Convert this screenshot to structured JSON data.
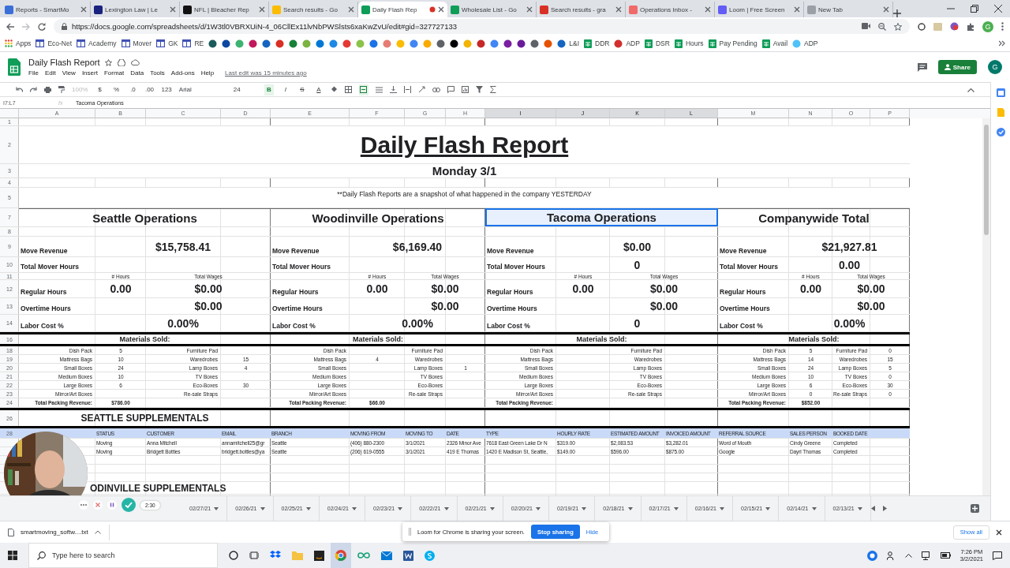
{
  "browser": {
    "tabs": [
      {
        "title": "Reports - SmartMo",
        "selected": false,
        "color": "#3b6fd8"
      },
      {
        "title": "Lexington Law | Le",
        "selected": false,
        "color": "#1a237e"
      },
      {
        "title": "NFL | Bleacher Rep",
        "selected": false,
        "color": "#111111"
      },
      {
        "title": "Search results - Go",
        "selected": false,
        "color": "#fbbc04"
      },
      {
        "title": "Daily Flash Rep",
        "selected": true,
        "color": "#0f9d58"
      },
      {
        "title": "Wholesale List - Go",
        "selected": false,
        "color": "#0f9d58"
      },
      {
        "title": "Search results - gra",
        "selected": false,
        "color": "#d93025"
      },
      {
        "title": "Operations Inbox -",
        "selected": false,
        "color": "#f06a6a"
      },
      {
        "title": "Loom | Free Screen",
        "selected": false,
        "color": "#625df5"
      },
      {
        "title": "New Tab",
        "selected": false,
        "color": "#9aa0a6"
      }
    ],
    "url": "https://docs.google.com/spreadsheets/d/1W3tl0VBRXUiN-4_06CllEx11lvNbPWSlsts6xaKwZvU/edit#gid=327727133",
    "profile": "G",
    "bookmarks": [
      {
        "kind": "apps",
        "label": "Apps"
      },
      {
        "kind": "page",
        "label": "Eco-Net"
      },
      {
        "kind": "page",
        "label": "Academy"
      },
      {
        "kind": "page",
        "label": "Mover"
      },
      {
        "kind": "page",
        "label": "GK"
      },
      {
        "kind": "page",
        "label": "RE"
      },
      {
        "kind": "site",
        "color": "#1a5a5a"
      },
      {
        "kind": "site",
        "color": "#0d47a1"
      },
      {
        "kind": "site",
        "color": "#3cb371"
      },
      {
        "kind": "site",
        "color": "#c2185b"
      },
      {
        "kind": "site",
        "color": "#1565c0"
      },
      {
        "kind": "site",
        "color": "#d93025"
      },
      {
        "kind": "site",
        "color": "#188038"
      },
      {
        "kind": "site",
        "color": "#7cb342"
      },
      {
        "kind": "site",
        "color": "#0078d4"
      },
      {
        "kind": "site",
        "color": "#1e88e5"
      },
      {
        "kind": "site",
        "color": "#e53935"
      },
      {
        "kind": "site",
        "color": "#8bc34a"
      },
      {
        "kind": "site",
        "color": "#1a73e8"
      },
      {
        "kind": "site",
        "color": "#e67c73"
      },
      {
        "kind": "site",
        "color": "#fbbc04"
      },
      {
        "kind": "site",
        "color": "#4285f4"
      },
      {
        "kind": "site",
        "color": "#f9ab00"
      },
      {
        "kind": "site",
        "color": "#5f6368"
      },
      {
        "kind": "site",
        "color": "#000000"
      },
      {
        "kind": "site",
        "color": "#f4b400"
      },
      {
        "kind": "site",
        "color": "#c62828"
      },
      {
        "kind": "site",
        "color": "#4285f5"
      },
      {
        "kind": "site",
        "color": "#7b1fa2"
      },
      {
        "kind": "site",
        "color": "#6a1b9a"
      },
      {
        "kind": "site",
        "color": "#5f6369"
      },
      {
        "kind": "site",
        "color": "#e65100"
      },
      {
        "kind": "site",
        "color": "#1565c1",
        "label": "L&I"
      },
      {
        "kind": "sheet",
        "label": "DDR"
      },
      {
        "kind": "site",
        "color": "#d32f2f",
        "label": "ADP"
      },
      {
        "kind": "sheet",
        "label": "DSR"
      },
      {
        "kind": "sheet",
        "label": "Hours"
      },
      {
        "kind": "sheet",
        "label": "Pay Pending"
      },
      {
        "kind": "sheet",
        "label": "Avail"
      },
      {
        "kind": "site",
        "color": "#4fc3f7",
        "label": "ADP"
      }
    ]
  },
  "doc": {
    "title": "Daily Flash Report",
    "menu": [
      "File",
      "Edit",
      "View",
      "Insert",
      "Format",
      "Data",
      "Tools",
      "Add-ons",
      "Help"
    ],
    "last_edit": "Last edit was 15 minutes ago",
    "share": "Share",
    "avatar": "G"
  },
  "toolbar": {
    "zoom": "100%",
    "currency": "$",
    "percent": "%",
    "decrease": ".0",
    "increase": ".00",
    "format": "123",
    "font": "Arial",
    "size": "24",
    "bold": "B",
    "italic": "I",
    "strike": "S",
    "text_color": "A",
    "bold_active": true,
    "merge_active": true
  },
  "formula": {
    "cell": "I7:L7",
    "fx": "fx",
    "value": "Tacoma Operations"
  },
  "sheet": {
    "columns": [
      {
        "letter": "A",
        "selected": false
      },
      {
        "letter": "B",
        "selected": false
      },
      {
        "letter": "C",
        "selected": false
      },
      {
        "letter": "D",
        "selected": false
      },
      {
        "letter": "E",
        "selected": false
      },
      {
        "letter": "F",
        "selected": false
      },
      {
        "letter": "G",
        "selected": false
      },
      {
        "letter": "H",
        "selected": false
      },
      {
        "letter": "I",
        "selected": true
      },
      {
        "letter": "J",
        "selected": true
      },
      {
        "letter": "K",
        "selected": true
      },
      {
        "letter": "L",
        "selected": true
      },
      {
        "letter": "M",
        "selected": false
      },
      {
        "letter": "N",
        "selected": false
      },
      {
        "letter": "O",
        "selected": false
      },
      {
        "letter": "P",
        "selected": false
      }
    ],
    "row_numbers": [
      "1",
      "2",
      "3",
      "4",
      "5",
      "7",
      "8",
      "9",
      "10",
      "11",
      "12",
      "13",
      "14",
      "16",
      "18",
      "19",
      "20",
      "21",
      "22",
      "23",
      "24",
      "26",
      "28"
    ],
    "title": "Daily Flash Report",
    "date": "Monday 3/1",
    "note": "**Daily Flash Reports are a snapshot of what happened in the company YESTERDAY",
    "sections": [
      {
        "header": "Seattle Operations",
        "selected": false,
        "move_revenue": {
          "label": "Move Revenue",
          "value": "$15,758.41"
        },
        "mover_hours": {
          "label": "Total Mover Hours"
        },
        "hours_head": "# Hours",
        "wages_head": "Total Wages",
        "regular": {
          "label": "Regular Hours",
          "hours": "0.00",
          "wages": "$0.00"
        },
        "overtime": {
          "label": "Overtime Hours",
          "wages": "$0.00"
        },
        "labor": {
          "label": "Labor Cost %",
          "value": "0.00%"
        },
        "materials_title": "Materials Sold:",
        "materials": [
          {
            "left": "Dish Pack",
            "left_qty": "5",
            "right": "Furniture Pad"
          },
          {
            "left": "Mattress Bags",
            "left_qty": "10",
            "right": "Waredrobes",
            "right_qty": "15"
          },
          {
            "left": "Small Boxes",
            "left_qty": "24",
            "right": "Lamp Boxes",
            "right_qty": "4"
          },
          {
            "left": "Medium Boxes",
            "left_qty": "10",
            "right": "TV Boxes"
          },
          {
            "left": "Large Boxes",
            "left_qty": "6",
            "right": "Eco-Boxes",
            "right_qty": "30"
          },
          {
            "left": "Mirror/Art Boxes",
            "right": "Re-sale Straps"
          }
        ],
        "total_label": "Total Packing Revenue:",
        "total": "$786.00"
      },
      {
        "header": "Woodinville Operations",
        "selected": false,
        "move_revenue": {
          "label": "Move Revenue",
          "value": "$6,169.40"
        },
        "mover_hours": {
          "label": "Total Mover Hours"
        },
        "hours_head": "# Hours",
        "wages_head": "Total Wages",
        "regular": {
          "label": "Regular Hours",
          "hours": "0.00",
          "wages": "$0.00"
        },
        "overtime": {
          "label": "Overtime Hours",
          "wages": "$0.00"
        },
        "labor": {
          "label": "Labor Cost %",
          "value": "0.00%"
        },
        "materials_title": "Materials Sold:",
        "materials": [
          {
            "left": "Dish Pack",
            "right": "Furniture Pad"
          },
          {
            "left": "Mattress Bags",
            "left_qty": "4",
            "right": "Waredrobes"
          },
          {
            "left": "Small Boxes",
            "right": "Lamp Boxes",
            "right_qty": "1"
          },
          {
            "left": "Medium Boxes",
            "right": "TV Boxes"
          },
          {
            "left": "Large Boxes",
            "right": "Eco-Boxes"
          },
          {
            "left": "Mirror/Art Boxes",
            "right": "Re-sale Straps"
          }
        ],
        "total_label": "Total Packing Revenue:",
        "total": "$66.00"
      },
      {
        "header": "Tacoma Operations",
        "selected": true,
        "move_revenue": {
          "label": "Move Revenue",
          "value": "$0.00"
        },
        "mover_hours": {
          "label": "Total Mover Hours",
          "value": "0"
        },
        "hours_head": "# Hours",
        "wages_head": "Total Wages",
        "regular": {
          "label": "Regular Hours",
          "hours": "0.00",
          "wages": "$0.00"
        },
        "overtime": {
          "label": "Overtime Hours",
          "wages": "$0.00"
        },
        "labor": {
          "label": "Labor Cost %",
          "value": "0"
        },
        "materials_title": "Materials Sold:",
        "materials": [
          {
            "left": "Dish Pack",
            "right": "Furniture Pad"
          },
          {
            "left": "Mattress Bags",
            "right": "Waredrobes"
          },
          {
            "left": "Small Boxes",
            "right": "Lamp Boxes"
          },
          {
            "left": "Medium Boxes",
            "right": "TV Boxes"
          },
          {
            "left": "Large Boxes",
            "right": "Eco-Boxes"
          },
          {
            "left": "Mirror/Art Boxes",
            "right": "Re-sale Straps"
          }
        ],
        "total_label": "Total Packing Revenue:"
      },
      {
        "header": "Companywide Total",
        "selected": false,
        "move_revenue": {
          "label": "Move Revenue",
          "value": "$21,927.81"
        },
        "mover_hours": {
          "label": "Total Mover Hours",
          "value": "0.00"
        },
        "hours_head": "# Hours",
        "wages_head": "Total Wages",
        "regular": {
          "label": "Regular Hours",
          "hours": "0.00",
          "wages": "$0.00"
        },
        "overtime": {
          "label": "Overtime Hours",
          "wages": "$0.00"
        },
        "labor": {
          "label": "Labor Cost %",
          "value": "0.00%"
        },
        "materials_title": "Materials Sold:",
        "materials": [
          {
            "left": "Dish Pack",
            "left_qty": "5",
            "right": "Furniture Pad",
            "right_qty": "0"
          },
          {
            "left": "Mattress Bags",
            "left_qty": "14",
            "right": "Waredrobes",
            "right_qty": "15"
          },
          {
            "left": "Small Boxes",
            "left_qty": "24",
            "right": "Lamp Boxes",
            "right_qty": "5"
          },
          {
            "left": "Medium Boxes",
            "left_qty": "10",
            "right": "TV Boxes",
            "right_qty": "0"
          },
          {
            "left": "Large Boxes",
            "left_qty": "6",
            "right": "Eco-Boxes",
            "right_qty": "30"
          },
          {
            "left": "Mirror/Art Boxes",
            "left_qty": "0",
            "right": "Re-sale Straps",
            "right_qty": "0"
          }
        ],
        "total_label": "Total Packing Revenue:",
        "total": "$852.00"
      }
    ],
    "supplementals": {
      "title": "SEATTLE SUPPLEMENTALS",
      "columns": [
        "STATUS",
        "CUSTOMER",
        "EMAIL",
        "BRANCH",
        "MOVING FROM",
        "MOVING TO",
        "DATE",
        "TYPE",
        "HOURLY RATE",
        "ESTIMATED AMOUNT",
        "INVOICED AMOUNT",
        "REFERRAL SOURCE",
        "SALES PERSON",
        "BOOKED DATE"
      ],
      "rows": [
        [
          "Moving",
          "Anna Mitchell",
          "annamitchell25@gr",
          "Seattle",
          "(406) 880-2300",
          "3/1/2021",
          "2326 Minor Ave",
          "7618 East Green Lake Dr N",
          "$319.00",
          "$2,083.53",
          "$3,282.01",
          "Word of Mouth",
          "Cindy Greene",
          "Completed"
        ],
        [
          "Moving",
          "Bridgett Bottles",
          "bridgett.bottles@ya",
          "Seattle",
          "(206) 619-0555",
          "3/1/2021",
          "419 E Thomas",
          "1420 E Madison St, Seattle,",
          "$149.00",
          "$596.00",
          "$875.00",
          "Google",
          "Dayrl Thomas",
          "Completed"
        ]
      ]
    },
    "next_title": "ODINVILLE SUPPLEMENTALS"
  },
  "sheet_tabs": [
    "02/27/21",
    "02/26/21",
    "02/25/21",
    "02/24/21",
    "02/23/21",
    "02/22/21",
    "02/21/21",
    "02/20/21",
    "02/19/21",
    "02/18/21",
    "02/17/21",
    "02/16/21",
    "02/15/21",
    "02/14/21",
    "02/13/21"
  ],
  "loom": {
    "timer": "2:30",
    "message": "Loom for Chrome is sharing your screen.",
    "stop": "Stop sharing",
    "hide": "Hide"
  },
  "downloads": {
    "file": "smartmoving_softw....txt",
    "show_all": "Show all"
  },
  "taskbar": {
    "search": "Type here to search",
    "time": "7:26 PM",
    "date": "3/2/2021"
  }
}
